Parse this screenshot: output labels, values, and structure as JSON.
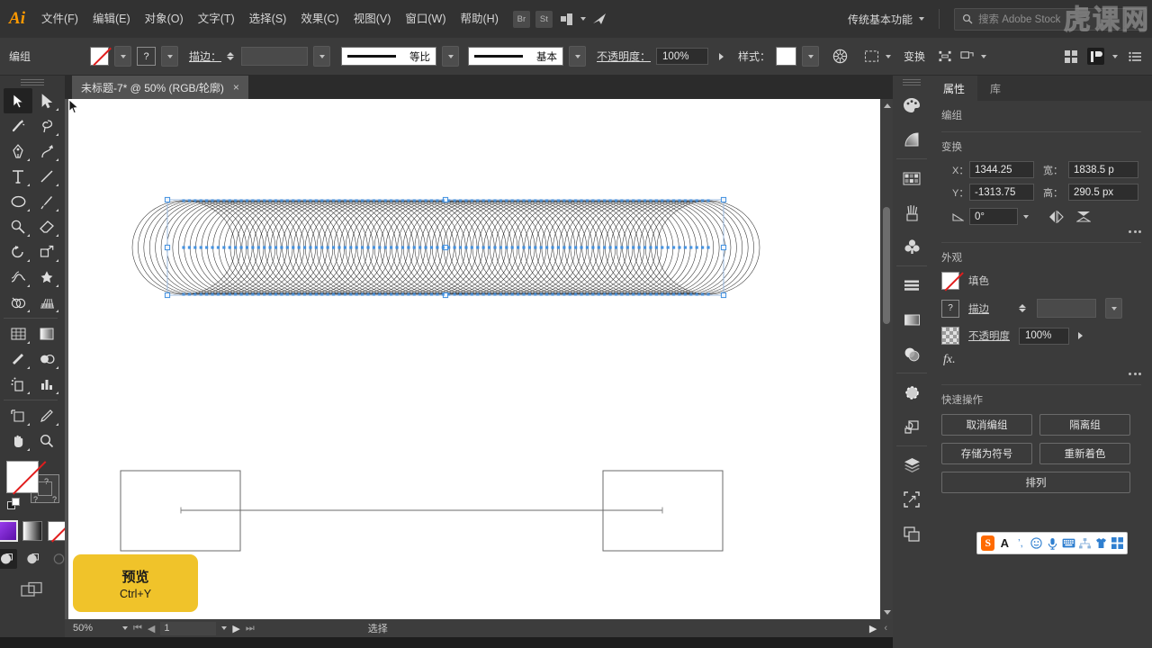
{
  "app": {
    "name": "Adobe Illustrator",
    "logo": "Ai",
    "workspace": "传统基本功能",
    "search_placeholder": "搜索 Adobe Stock",
    "watermark": [
      "虎",
      "课",
      "网"
    ]
  },
  "menu": {
    "items": [
      {
        "label": "文件(F)"
      },
      {
        "label": "编辑(E)"
      },
      {
        "label": "对象(O)"
      },
      {
        "label": "文字(T)"
      },
      {
        "label": "选择(S)"
      },
      {
        "label": "效果(C)"
      },
      {
        "label": "视图(V)"
      },
      {
        "label": "窗口(W)"
      },
      {
        "label": "帮助(H)"
      }
    ],
    "bridge_label": "Br",
    "stock_label": "St"
  },
  "control_bar": {
    "object_label": "编组",
    "fill_swatch": "none",
    "stroke_swatch": "?",
    "stroke_label": "描边：",
    "stroke_weight": "",
    "profile_uniform": "等比",
    "profile_basic": "基本",
    "opacity_label": "不透明度：",
    "opacity_value": "100%",
    "style_label": "样式：",
    "transform_label": "变换"
  },
  "document": {
    "tab_title": "未标题-7* @ 50% (RGB/轮廓)",
    "close_label": "×"
  },
  "status_bar": {
    "zoom": "50%",
    "page": "1",
    "tool_status": "选择"
  },
  "tooltip": {
    "title": "预览",
    "shortcut": "Ctrl+Y"
  },
  "properties": {
    "tabs": [
      {
        "label": "属性",
        "active": true
      },
      {
        "label": "库",
        "active": false
      }
    ],
    "object_type": "编组",
    "transform": {
      "title": "变换",
      "x_label": "X：",
      "x_value": "1344.25",
      "y_label": "Y：",
      "y_value": "-1313.75",
      "w_label": "宽：",
      "w_value": "1838.5 p",
      "h_label": "高：",
      "h_value": "290.5 px",
      "angle_value": "0°"
    },
    "appearance": {
      "title": "外观",
      "fill_label": "填色",
      "stroke_label": "描边",
      "stroke_value": "",
      "opacity_label": "不透明度",
      "opacity_value": "100%",
      "fx_label": "fx."
    },
    "quick_actions": {
      "title": "快速操作",
      "buttons": [
        {
          "label": "取消编组",
          "size": "half"
        },
        {
          "label": "隔离组",
          "size": "half"
        },
        {
          "label": "存储为符号",
          "size": "half"
        },
        {
          "label": "重新着色",
          "size": "half"
        },
        {
          "label": "排列",
          "size": "full"
        }
      ]
    }
  },
  "toolbar": {
    "tools": [
      {
        "name": "selection-tool",
        "selected": true
      },
      {
        "name": "direct-selection-tool",
        "selected": false
      },
      {
        "name": "magic-wand-tool",
        "selected": false
      },
      {
        "name": "lasso-tool",
        "selected": false
      },
      {
        "name": "pen-tool",
        "selected": false
      },
      {
        "name": "curvature-tool",
        "selected": false
      },
      {
        "name": "type-tool",
        "selected": false
      },
      {
        "name": "line-segment-tool",
        "selected": false
      },
      {
        "name": "ellipse-tool",
        "selected": false
      },
      {
        "name": "paintbrush-tool",
        "selected": false
      },
      {
        "name": "shaper-tool",
        "selected": false
      },
      {
        "name": "eraser-tool",
        "selected": false
      },
      {
        "name": "rotate-tool",
        "selected": false
      },
      {
        "name": "scale-tool",
        "selected": false
      },
      {
        "name": "width-tool",
        "selected": false
      },
      {
        "name": "free-transform-tool",
        "selected": false
      },
      {
        "name": "shape-builder-tool",
        "selected": false
      },
      {
        "name": "perspective-grid-tool",
        "selected": false
      },
      {
        "name": "mesh-tool",
        "selected": false
      },
      {
        "name": "gradient-tool",
        "selected": false
      },
      {
        "name": "eyedropper-tool",
        "selected": false
      },
      {
        "name": "blend-tool",
        "selected": false
      },
      {
        "name": "symbol-sprayer-tool",
        "selected": false
      },
      {
        "name": "column-graph-tool",
        "selected": false
      },
      {
        "name": "artboard-tool",
        "selected": false
      },
      {
        "name": "slice-tool",
        "selected": false
      },
      {
        "name": "hand-tool",
        "selected": false
      },
      {
        "name": "zoom-tool",
        "selected": false
      }
    ],
    "color_modes": [
      {
        "name": "color-swatch",
        "color": "#7a1fd6"
      },
      {
        "name": "gradient-swatch",
        "color": "#ffffff"
      },
      {
        "name": "none-swatch",
        "color": "#ffffff"
      }
    ],
    "screen_modes": [
      {
        "name": "draw-normal",
        "selected": true
      },
      {
        "name": "draw-behind",
        "selected": false
      },
      {
        "name": "draw-inside",
        "selected": false
      }
    ]
  },
  "dock": {
    "icons": [
      {
        "name": "color-panel-icon"
      },
      {
        "name": "gradient-panel-icon"
      },
      {
        "name": "swatches-panel-icon"
      },
      {
        "name": "brushes-panel-icon"
      },
      {
        "name": "symbols-panel-icon"
      },
      {
        "name": "align-panel-icon"
      },
      {
        "name": "gradient-mesh-icon"
      },
      {
        "name": "transparency-panel-icon"
      },
      {
        "name": "stroke-panel-icon"
      },
      {
        "name": "pathfinder-panel-icon"
      },
      {
        "name": "layers-panel-icon"
      },
      {
        "name": "artboards-panel-icon"
      },
      {
        "name": "links-panel-icon"
      }
    ]
  },
  "ime": {
    "icons": [
      "sogou-logo",
      "A",
      "punctuation",
      "emoji",
      "voice",
      "keyboard",
      "network",
      "skin",
      "apps"
    ]
  },
  "artwork": {
    "circle_count": 92,
    "selection_color": "#3f8fe0",
    "stroke_color": "#2a2a2a"
  }
}
